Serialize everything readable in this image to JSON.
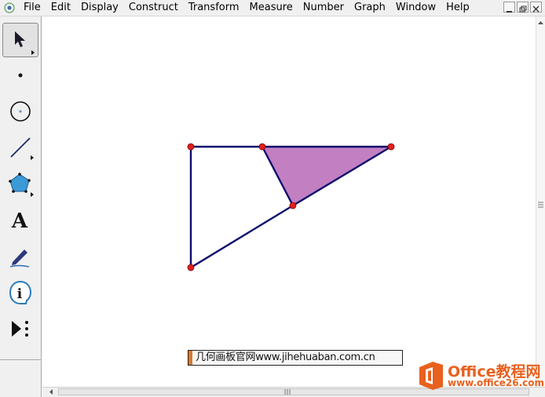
{
  "menu": {
    "items": [
      "File",
      "Edit",
      "Display",
      "Construct",
      "Transform",
      "Measure",
      "Number",
      "Graph",
      "Window",
      "Help"
    ]
  },
  "window_controls": [
    "minimize",
    "restore",
    "close"
  ],
  "toolbox": {
    "tools": [
      {
        "name": "arrow-select-tool",
        "icon": "arrow-pointer-icon",
        "selected": true
      },
      {
        "name": "point-tool",
        "icon": "point-icon",
        "selected": false
      },
      {
        "name": "compass-tool",
        "icon": "circle-icon",
        "selected": false
      },
      {
        "name": "straightedge-tool",
        "icon": "segment-icon",
        "selected": false
      },
      {
        "name": "polygon-tool",
        "icon": "pentagon-icon",
        "selected": false
      },
      {
        "name": "text-tool",
        "icon": "letter-a-icon",
        "selected": false
      },
      {
        "name": "marker-tool",
        "icon": "pen-icon",
        "selected": false
      },
      {
        "name": "information-tool",
        "icon": "info-icon",
        "selected": false
      },
      {
        "name": "custom-tool",
        "icon": "play-more-icon",
        "selected": false
      }
    ],
    "text_tool_glyph": "A",
    "info_tool_glyph": "i"
  },
  "colors": {
    "segment": "#0e0e6e",
    "point": "#e02020",
    "fill": "#c27fc2",
    "selected_tool": "#e2e2e2",
    "office_orange": "#e8611e"
  },
  "watermark": {
    "text": "几何画板官网www.jihehuaban.com.cn"
  },
  "office_logo": {
    "name": "Office教程网",
    "url": "www.office26.com"
  }
}
